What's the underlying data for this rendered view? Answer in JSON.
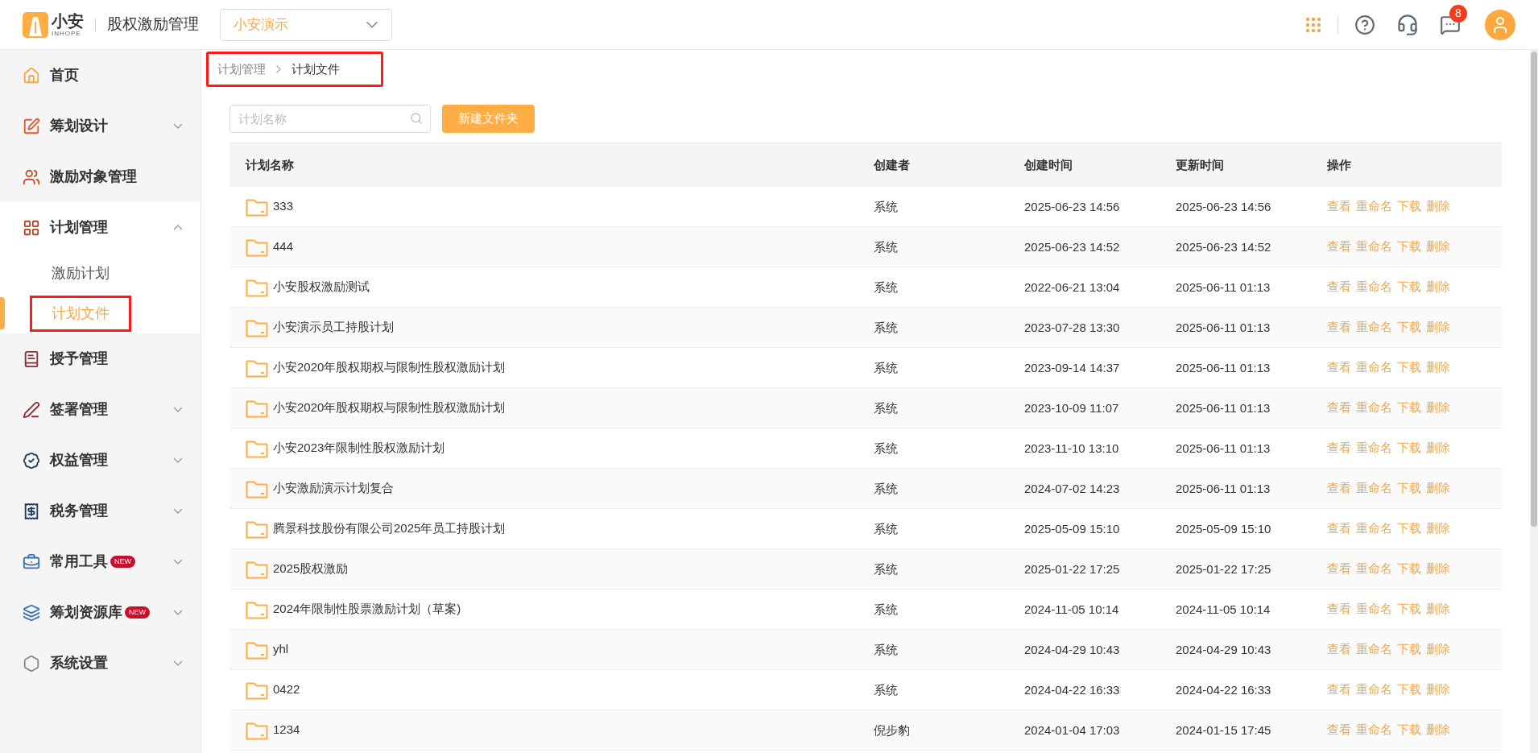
{
  "header": {
    "logo_text": "小安",
    "logo_subtext": "INHOPE",
    "app_title": "股权激励管理",
    "company_select": {
      "value": "小安演示"
    },
    "notification_count": "8"
  },
  "sidebar": {
    "items": [
      {
        "label": "首页"
      },
      {
        "label": "筹划设计",
        "expanded": false
      },
      {
        "label": "激励对象管理"
      },
      {
        "label": "计划管理",
        "expanded": true,
        "children": [
          {
            "label": "激励计划",
            "selected": false,
            "highlighted": false
          },
          {
            "label": "计划文件",
            "selected": true,
            "highlighted": true
          }
        ]
      },
      {
        "label": "授予管理"
      },
      {
        "label": "签署管理",
        "expanded": false
      },
      {
        "label": "权益管理",
        "expanded": false
      },
      {
        "label": "税务管理",
        "expanded": false
      },
      {
        "label": "常用工具",
        "expanded": false,
        "badge": "NEW"
      },
      {
        "label": "筹划资源库",
        "expanded": false,
        "badge": "NEW"
      },
      {
        "label": "系统设置",
        "expanded": false
      }
    ]
  },
  "breadcrumb": {
    "highlighted": true,
    "items": [
      "计划管理",
      "计划文件"
    ]
  },
  "search": {
    "placeholder": "计划名称"
  },
  "new_folder_button": "新建文件夹",
  "table": {
    "columns": [
      "计划名称",
      "创建者",
      "创建时间",
      "更新时间",
      "操作"
    ],
    "rows": [
      {
        "name": "333",
        "creator": "系统",
        "created": "2025-06-23 14:56",
        "updated": "2025-06-23 14:56",
        "actions": [
          "查看",
          "重命名",
          "下载",
          "删除"
        ]
      },
      {
        "name": "444",
        "creator": "系统",
        "created": "2025-06-23 14:52",
        "updated": "2025-06-23 14:52",
        "actions": [
          "查看",
          "重命名",
          "下载",
          "删除"
        ]
      },
      {
        "name": "小安股权激励测试",
        "creator": "系统",
        "created": "2022-06-21 13:04",
        "updated": "2025-06-11 01:13",
        "actions": [
          "查看",
          "重命名",
          "下载",
          "删除"
        ]
      },
      {
        "name": "小安演示员工持股计划",
        "creator": "系统",
        "created": "2023-07-28 13:30",
        "updated": "2025-06-11 01:13",
        "actions": [
          "查看",
          "重命名",
          "下载",
          "删除"
        ]
      },
      {
        "name": "小安2020年股权期权与限制性股权激励计划",
        "creator": "系统",
        "created": "2023-09-14 14:37",
        "updated": "2025-06-11 01:13",
        "actions": [
          "查看",
          "重命名",
          "下载",
          "删除"
        ]
      },
      {
        "name": "小安2020年股权期权与限制性股权激励计划",
        "creator": "系统",
        "created": "2023-10-09 11:07",
        "updated": "2025-06-11 01:13",
        "actions": [
          "查看",
          "重命名",
          "下载",
          "删除"
        ]
      },
      {
        "name": "小安2023年限制性股权激励计划",
        "creator": "系统",
        "created": "2023-11-10 13:10",
        "updated": "2025-06-11 01:13",
        "actions": [
          "查看",
          "重命名",
          "下载",
          "删除"
        ]
      },
      {
        "name": "小安激励演示计划复合",
        "creator": "系统",
        "created": "2024-07-02 14:23",
        "updated": "2025-06-11 01:13",
        "actions": [
          "查看",
          "重命名",
          "下载",
          "删除"
        ]
      },
      {
        "name": "腾景科技股份有限公司2025年员工持股计划",
        "creator": "系统",
        "created": "2025-05-09 15:10",
        "updated": "2025-05-09 15:10",
        "actions": [
          "查看",
          "重命名",
          "下载",
          "删除"
        ]
      },
      {
        "name": "2025股权激励",
        "creator": "系统",
        "created": "2025-01-22 17:25",
        "updated": "2025-01-22 17:25",
        "actions": [
          "查看",
          "重命名",
          "下载",
          "删除"
        ]
      },
      {
        "name": "2024年限制性股票激励计划（草案)",
        "creator": "系统",
        "created": "2024-11-05 10:14",
        "updated": "2024-11-05 10:14",
        "actions": [
          "查看",
          "重命名",
          "下载",
          "删除"
        ]
      },
      {
        "name": "yhl",
        "creator": "系统",
        "created": "2024-04-29 10:43",
        "updated": "2024-04-29 10:43",
        "actions": [
          "查看",
          "重命名",
          "下载",
          "删除"
        ]
      },
      {
        "name": "0422",
        "creator": "系统",
        "created": "2024-04-22 16:33",
        "updated": "2024-04-22 16:33",
        "actions": [
          "查看",
          "重命名",
          "下载",
          "删除"
        ]
      },
      {
        "name": "1234",
        "creator": "倪步豹",
        "created": "2024-01-04 17:03",
        "updated": "2024-01-15 17:45",
        "actions": [
          "查看",
          "重命名",
          "下载",
          "删除"
        ]
      }
    ]
  }
}
